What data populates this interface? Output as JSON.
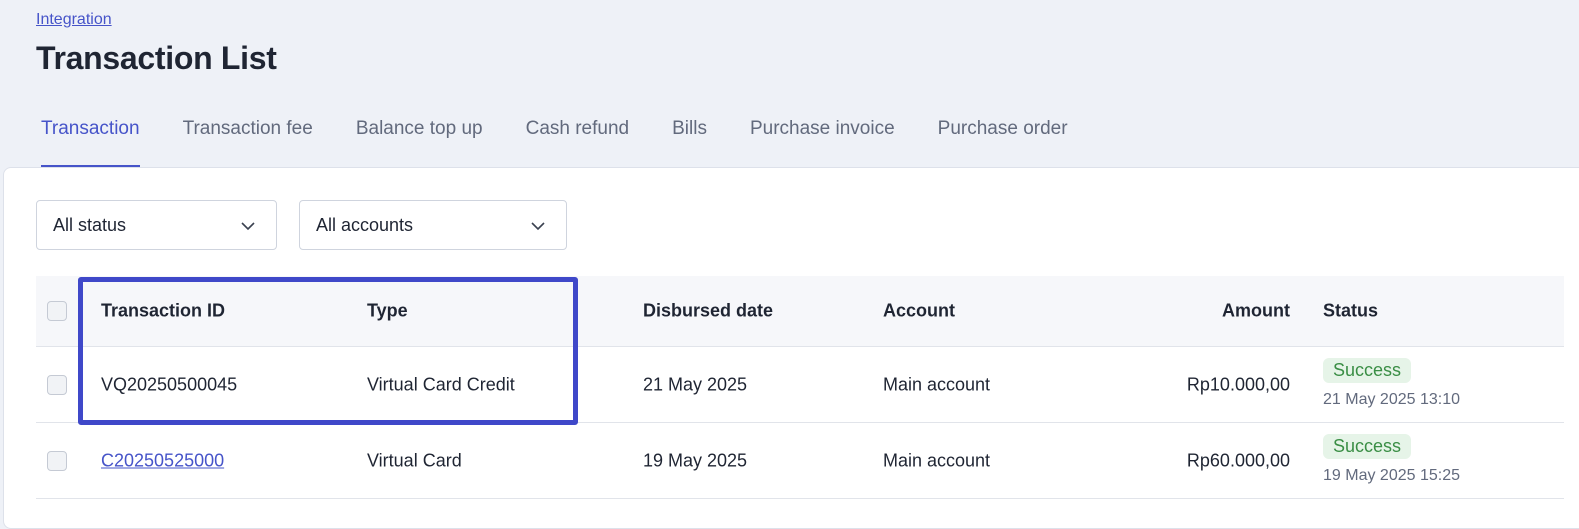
{
  "breadcrumb": "Integration",
  "page_title": "Transaction List",
  "tabs": [
    {
      "label": "Transaction",
      "active": true
    },
    {
      "label": "Transaction fee",
      "active": false
    },
    {
      "label": "Balance top up",
      "active": false
    },
    {
      "label": "Cash refund",
      "active": false
    },
    {
      "label": "Bills",
      "active": false
    },
    {
      "label": "Purchase invoice",
      "active": false
    },
    {
      "label": "Purchase order",
      "active": false
    }
  ],
  "filters": {
    "status": {
      "value": "All status",
      "icon": "chevron-down-icon"
    },
    "accounts": {
      "value": "All accounts",
      "icon": "chevron-down-icon"
    }
  },
  "table": {
    "headers": {
      "transaction_id": "Transaction ID",
      "type": "Type",
      "disbursed_date": "Disbursed date",
      "account": "Account",
      "amount": "Amount",
      "status": "Status"
    },
    "rows": [
      {
        "transaction_id": "VQ20250500045",
        "is_link": false,
        "type": "Virtual Card Credit",
        "disbursed_date": "21 May 2025",
        "account": "Main account",
        "amount": "Rp10.000,00",
        "status": "Success",
        "status_time": "21 May 2025 13:10"
      },
      {
        "transaction_id": "C20250525000",
        "is_link": true,
        "type": "Virtual Card",
        "disbursed_date": "19 May 2025",
        "account": "Main account",
        "amount": "Rp60.000,00",
        "status": "Success",
        "status_time": "19 May 2025 15:25"
      }
    ]
  },
  "colors": {
    "accent": "#4654c9",
    "highlight_border": "#3f48c9",
    "success_bg": "#e6f4e8",
    "success_text": "#3a8e45",
    "page_bg": "#eef1f7"
  }
}
